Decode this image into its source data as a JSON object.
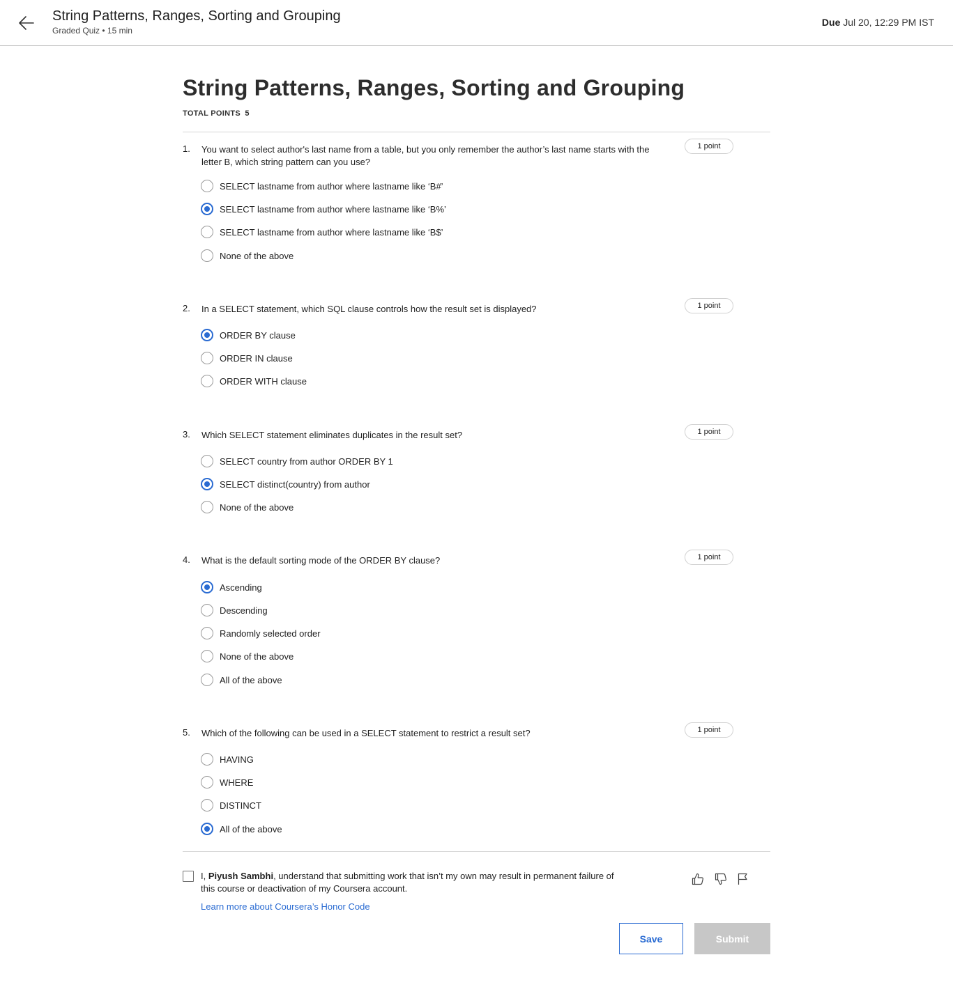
{
  "header": {
    "title": "String Patterns, Ranges, Sorting and Grouping",
    "subtitle": "Graded Quiz • 15 min",
    "due_label": "Due",
    "due_value": "Jul 20, 12:29 PM IST"
  },
  "main": {
    "title": "String Patterns, Ranges, Sorting and Grouping",
    "total_points_label": "TOTAL POINTS",
    "total_points_value": "5"
  },
  "questions": [
    {
      "number": "1.",
      "text": "You want to select author's last name from a table, but you only remember the author’s last name starts with the letter B, which string pattern can you use?",
      "points": "1 point",
      "options": [
        {
          "label": "SELECT lastname from author where lastname like ‘B#’",
          "selected": false
        },
        {
          "label": "SELECT lastname from author where lastname like ‘B%’",
          "selected": true
        },
        {
          "label": "SELECT lastname from author where lastname like ‘B$’",
          "selected": false
        },
        {
          "label": "None of the above",
          "selected": false
        }
      ]
    },
    {
      "number": "2.",
      "text": "In a SELECT statement, which SQL clause controls how the result set is displayed?",
      "points": "1 point",
      "options": [
        {
          "label": "ORDER BY clause",
          "selected": true
        },
        {
          "label": "ORDER IN clause",
          "selected": false
        },
        {
          "label": "ORDER WITH clause",
          "selected": false
        }
      ]
    },
    {
      "number": "3.",
      "text": "Which SELECT statement eliminates duplicates in the result set?",
      "points": "1 point",
      "options": [
        {
          "label": "SELECT country from author ORDER BY 1",
          "selected": false
        },
        {
          "label": "SELECT distinct(country) from author",
          "selected": true
        },
        {
          "label": "None of the above",
          "selected": false
        }
      ]
    },
    {
      "number": "4.",
      "text": "What is the default sorting mode of the ORDER BY clause?",
      "points": "1 point",
      "options": [
        {
          "label": "Ascending",
          "selected": true
        },
        {
          "label": "Descending",
          "selected": false
        },
        {
          "label": "Randomly selected order",
          "selected": false
        },
        {
          "label": "None of the above",
          "selected": false
        },
        {
          "label": "All of the above",
          "selected": false
        }
      ]
    },
    {
      "number": "5.",
      "text": "Which of the following can be used in a SELECT statement to restrict a result set?",
      "points": "1 point",
      "options": [
        {
          "label": "HAVING",
          "selected": false
        },
        {
          "label": "WHERE",
          "selected": false
        },
        {
          "label": "DISTINCT",
          "selected": false
        },
        {
          "label": "All of the above",
          "selected": true
        }
      ]
    }
  ],
  "honor": {
    "prefix": "I,",
    "name": "Piyush Sambhi",
    "suffix": ", understand that submitting work that isn’t my own may result in permanent failure of this course or deactivation of my Coursera account.",
    "link_label": "Learn more about Coursera’s Honor Code",
    "checked": false
  },
  "feedback_icons": [
    "thumbs-up-icon",
    "thumbs-down-icon",
    "flag-icon"
  ],
  "actions": {
    "save_label": "Save",
    "submit_label": "Submit"
  },
  "colors": {
    "accent": "#2a6bd2",
    "disabled_button": "#c7c7c7"
  }
}
